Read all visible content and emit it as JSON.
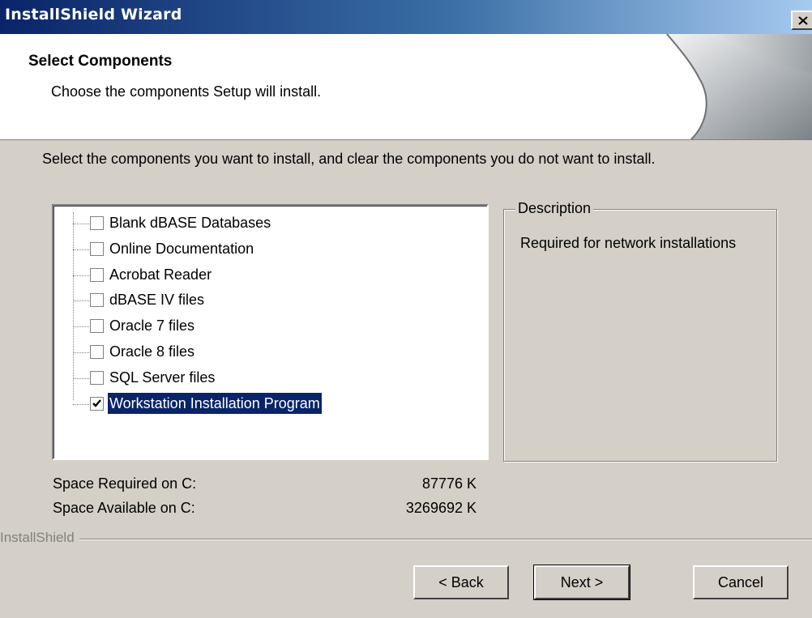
{
  "window": {
    "title": "InstallShield Wizard"
  },
  "header": {
    "title": "Select Components",
    "subtitle": "Choose the components Setup will install."
  },
  "instruction": "Select the components you want to install, and clear the components you do not want to install.",
  "components": [
    {
      "label": "Blank dBASE Databases",
      "checked": false,
      "selected": false
    },
    {
      "label": "Online Documentation",
      "checked": false,
      "selected": false
    },
    {
      "label": "Acrobat Reader",
      "checked": false,
      "selected": false
    },
    {
      "label": "dBASE IV files",
      "checked": false,
      "selected": false
    },
    {
      "label": "Oracle 7 files",
      "checked": false,
      "selected": false
    },
    {
      "label": "Oracle 8 files",
      "checked": false,
      "selected": false
    },
    {
      "label": "SQL Server files",
      "checked": false,
      "selected": false
    },
    {
      "label": "Workstation Installation Program",
      "checked": true,
      "selected": true
    }
  ],
  "description": {
    "legend": "Description",
    "text": "Required for network installations"
  },
  "space": {
    "required_label": "Space Required on  C:",
    "required_value": "87776 K",
    "available_label": "Space Available on  C:",
    "available_value": "3269692 K"
  },
  "brand": "InstallShield",
  "buttons": {
    "back": "< Back",
    "next": "Next >",
    "cancel": "Cancel"
  },
  "colors": {
    "titlebar_start": "#0a246a",
    "titlebar_end": "#a6caf0",
    "selection": "#0a246a",
    "face": "#d4d0c8"
  }
}
